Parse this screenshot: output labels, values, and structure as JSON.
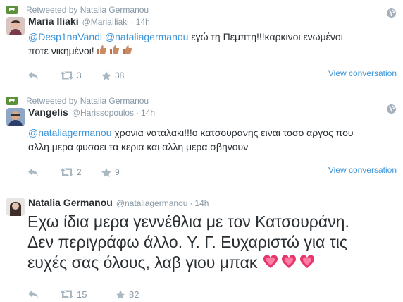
{
  "tweets": [
    {
      "retweet_label": "Retweeted by Natalia Germanou",
      "fullname": "Maria Iliaki",
      "handle": "@MariaIliaki",
      "dot": "·",
      "time": "14h",
      "mention1": "@Desp1naVandi",
      "mention2": "@nataliagermanou",
      "text_line1_rest": " εγώ τη Πεμπτη!!!καρκινοι ενωμένοι",
      "text_line2": "ποτε νικημένοι!",
      "retweets": "3",
      "favorites": "38",
      "view_conversation": "View conversation"
    },
    {
      "retweet_label": "Retweeted by Natalia Germanou",
      "fullname": "Vangelis",
      "handle": "@Harissopoulos",
      "dot": "·",
      "time": "14h",
      "mention1": "@nataliagermanou",
      "text_line1_rest": " χρονια  ναταλακι!!!ο κατσουρανης ειναι τοσο αργος που",
      "text_line2": "αλλη μερα φυσαει τα κερια και αλλη μερα σβηνουν",
      "retweets": "2",
      "favorites": "9",
      "view_conversation": "View conversation"
    },
    {
      "fullname": "Natalia Germanou",
      "handle": "@nataliagermanou",
      "dot": "·",
      "time": "14h",
      "big_line1": "Εχω ίδια μερα γεννέθλια με τον Κατσουράνη.",
      "big_line2": "Δεν περιγράφω άλλο. Υ. Γ. Ευχαριστώ για τις",
      "big_line3": "ευχές σας όλους, λαβ γιου μπακ",
      "retweets": "15",
      "favorites": "82"
    }
  ],
  "icons": {
    "retweet": "retweet-icon",
    "reply": "reply-icon",
    "favorite": "star-icon",
    "globe": "globe-icon",
    "thumbs": "thumbs-up-emoji",
    "heart": "sparkling-heart-emoji"
  },
  "colors": {
    "link": "#3b94d9",
    "muted": "#8899a6",
    "retweet_green": "#5c913b",
    "text": "#292f33"
  }
}
